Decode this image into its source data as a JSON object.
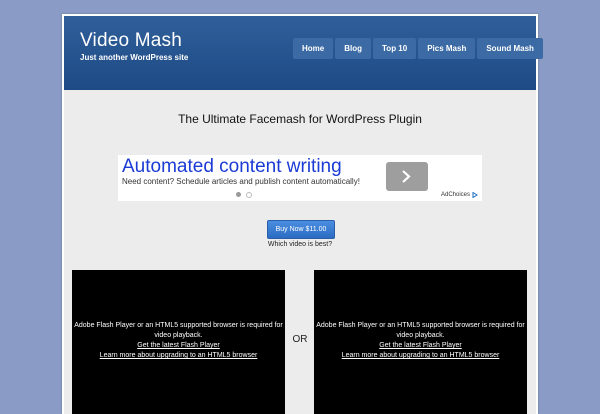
{
  "header": {
    "site_title": "Video Mash",
    "tagline": "Just another WordPress site",
    "nav": [
      {
        "label": "Home"
      },
      {
        "label": "Blog"
      },
      {
        "label": "Top 10"
      },
      {
        "label": "Pics Mash"
      },
      {
        "label": "Sound Mash"
      }
    ]
  },
  "main": {
    "page_title": "The Ultimate Facemash for WordPress Plugin",
    "ad": {
      "headline": "Automated content writing",
      "description": "Need content? Schedule articles and publish content automatically!",
      "adchoices": "AdChoices"
    },
    "buy_button": "Buy Now $11.00",
    "question": "Which video is best?",
    "or_label": "OR",
    "players": [
      {
        "message": "Adobe Flash Player or an HTML5 supported browser is required for video playback.",
        "link1": "Get the latest Flash Player",
        "link2": "Learn more about upgrading to an HTML5 browser"
      },
      {
        "message": "Adobe Flash Player or an HTML5 supported browser is required for video playback.",
        "link1": "Get the latest Flash Player",
        "link2": "Learn more about upgrading to an HTML5 browser"
      }
    ]
  },
  "colors": {
    "page_bg": "#8a9cc6",
    "header_bg": "#1e4a85",
    "content_bg": "#ececec",
    "ad_headline": "#1a3bd6"
  },
  "icons": [
    "chevron-right-icon",
    "adchoices-icon"
  ]
}
